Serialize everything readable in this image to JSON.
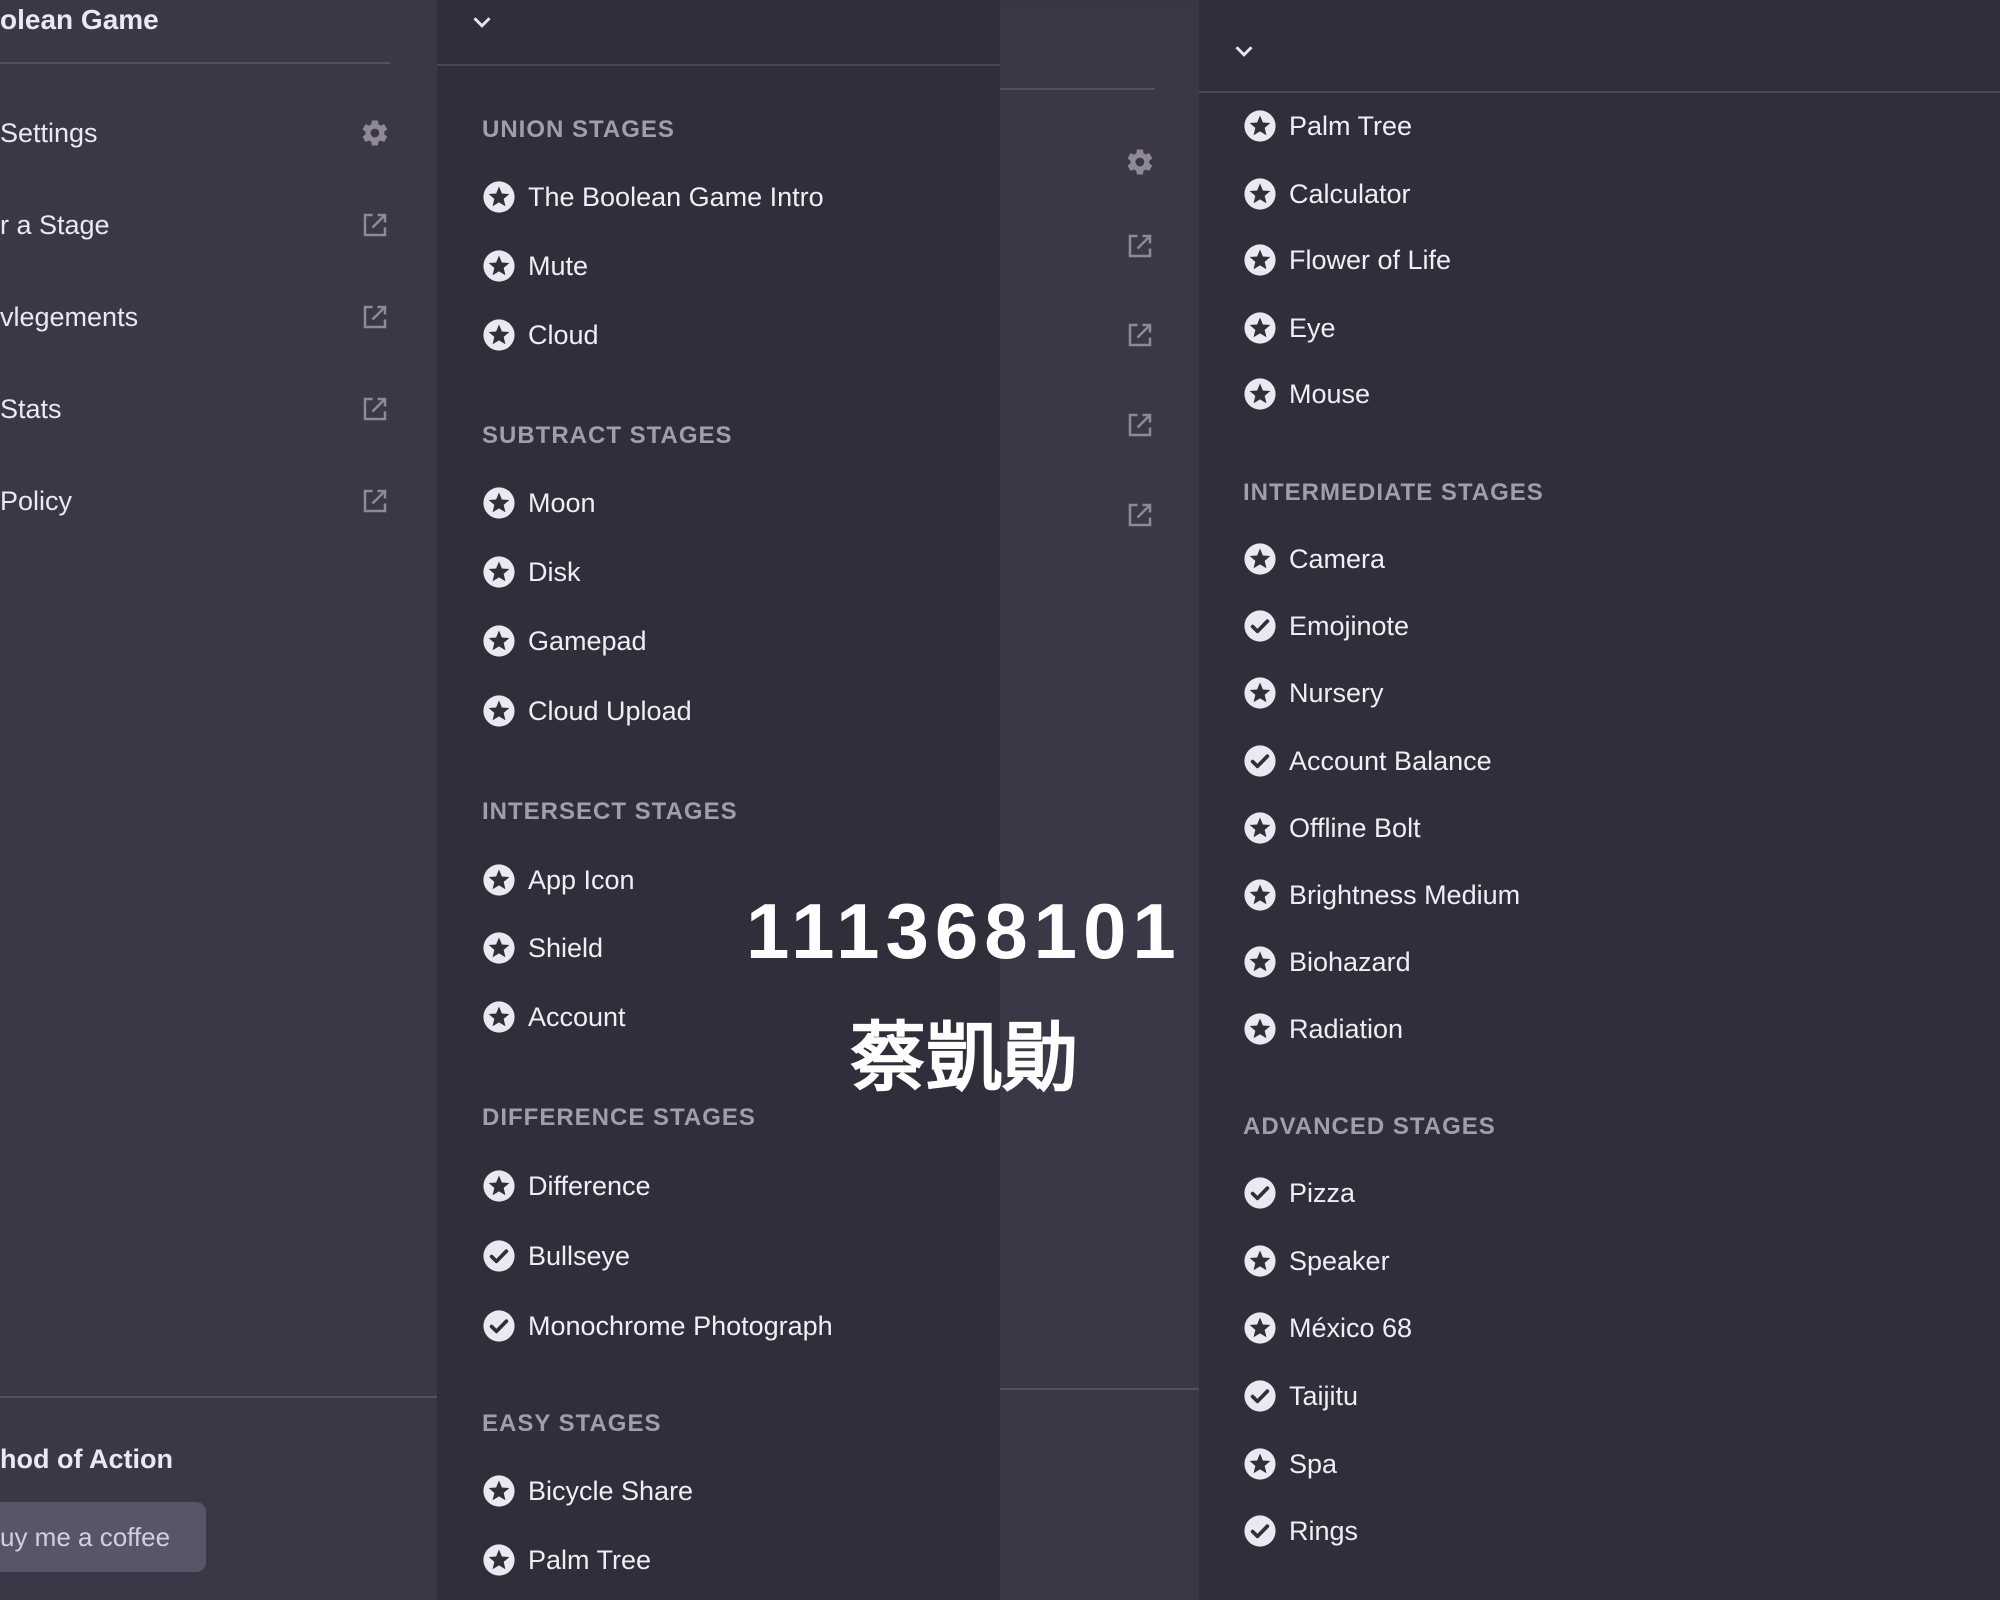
{
  "left_sidebar": {
    "title": "olean Game",
    "items": [
      {
        "label": "Settings",
        "icon": "gear-icon"
      },
      {
        "label": "r a Stage",
        "icon": "external-link-icon"
      },
      {
        "label": "vlegements",
        "icon": "external-link-icon"
      },
      {
        "label": "Stats",
        "icon": "external-link-icon"
      },
      {
        "label": " Policy",
        "icon": "external-link-icon"
      }
    ],
    "footer_title": "hod of Action",
    "coffee_button": "uy me a coffee"
  },
  "stage_list_1": {
    "sections": [
      {
        "header": "UNION STAGES",
        "stages": [
          {
            "label": "The Boolean Game Intro",
            "icon": "star-icon"
          },
          {
            "label": "Mute",
            "icon": "star-icon"
          },
          {
            "label": "Cloud",
            "icon": "star-icon"
          }
        ]
      },
      {
        "header": "SUBTRACT STAGES",
        "stages": [
          {
            "label": "Moon",
            "icon": "star-icon"
          },
          {
            "label": "Disk",
            "icon": "star-icon"
          },
          {
            "label": "Gamepad",
            "icon": "star-icon"
          },
          {
            "label": "Cloud Upload",
            "icon": "star-icon"
          }
        ]
      },
      {
        "header": "INTERSECT STAGES",
        "stages": [
          {
            "label": "App Icon",
            "icon": "star-icon"
          },
          {
            "label": "Shield",
            "icon": "star-icon"
          },
          {
            "label": "Account",
            "icon": "star-icon"
          }
        ]
      },
      {
        "header": "DIFFERENCE STAGES",
        "stages": [
          {
            "label": "Difference",
            "icon": "star-icon"
          },
          {
            "label": "Bullseye",
            "icon": "check-icon"
          },
          {
            "label": "Monochrome Photograph",
            "icon": "check-icon"
          }
        ]
      },
      {
        "header": "EASY STAGES",
        "stages": [
          {
            "label": "Bicycle Share",
            "icon": "star-icon"
          },
          {
            "label": "Palm Tree",
            "icon": "star-icon"
          }
        ]
      }
    ]
  },
  "stage_list_2": {
    "top_stages": [
      {
        "label": "Palm Tree",
        "icon": "star-icon"
      },
      {
        "label": "Calculator",
        "icon": "star-icon"
      },
      {
        "label": "Flower of Life",
        "icon": "star-icon"
      },
      {
        "label": "Eye",
        "icon": "star-icon"
      },
      {
        "label": "Mouse",
        "icon": "star-icon"
      }
    ],
    "sections": [
      {
        "header": "INTERMEDIATE STAGES",
        "stages": [
          {
            "label": "Camera",
            "icon": "star-icon"
          },
          {
            "label": "Emojinote",
            "icon": "check-icon"
          },
          {
            "label": "Nursery",
            "icon": "star-icon"
          },
          {
            "label": "Account Balance",
            "icon": "check-icon"
          },
          {
            "label": "Offline Bolt",
            "icon": "star-icon"
          },
          {
            "label": "Brightness Medium",
            "icon": "star-icon"
          },
          {
            "label": "Biohazard",
            "icon": "star-icon"
          },
          {
            "label": "Radiation",
            "icon": "star-icon"
          }
        ]
      },
      {
        "header": "ADVANCED STAGES",
        "stages": [
          {
            "label": "Pizza",
            "icon": "check-icon"
          },
          {
            "label": "Speaker",
            "icon": "star-icon"
          },
          {
            "label": "México 68",
            "icon": "star-icon"
          },
          {
            "label": "Taijitu",
            "icon": "check-icon"
          },
          {
            "label": "Spa",
            "icon": "star-icon"
          },
          {
            "label": "Rings",
            "icon": "check-icon"
          }
        ]
      }
    ]
  },
  "overlay": {
    "number": "111368101",
    "name": "蔡凱勛"
  }
}
